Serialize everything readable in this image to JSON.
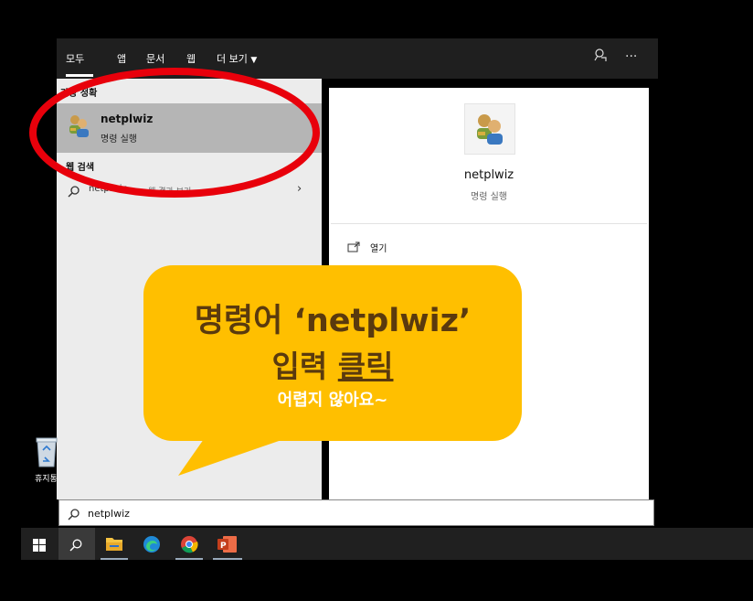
{
  "header": {
    "tabs": [
      "모두",
      "앱",
      "문서",
      "웹",
      "더 보기"
    ]
  },
  "best_match": {
    "section": "가장 정확",
    "name": "netplwiz",
    "subtitle": "명령 실행"
  },
  "web_search": {
    "section": "웹 검색",
    "query": "netplwiz",
    "suffix": "- 웹 결과 보기"
  },
  "detail": {
    "name": "netplwiz",
    "subtitle": "명령 실행",
    "actions": [
      "열기"
    ]
  },
  "callout": {
    "line1": "명령어 ‘netplwiz’",
    "line2a": "입력",
    "line2b": "클릭",
    "line3": "어렵지 않아요~"
  },
  "desktop": {
    "recycle_bin_label": "휴지통"
  },
  "search_box": {
    "value": "netplwiz"
  },
  "colors": {
    "highlight_ring": "#e8000b",
    "callout_bg": "#ffbf00",
    "callout_text": "#5a3a0e"
  },
  "icons": [
    "search-icon",
    "feedback-icon",
    "more-icon",
    "chevron-right-icon",
    "open-icon",
    "windows-start-icon",
    "file-explorer-icon",
    "edge-icon",
    "chrome-icon",
    "powerpoint-icon",
    "recycle-bin-icon"
  ]
}
